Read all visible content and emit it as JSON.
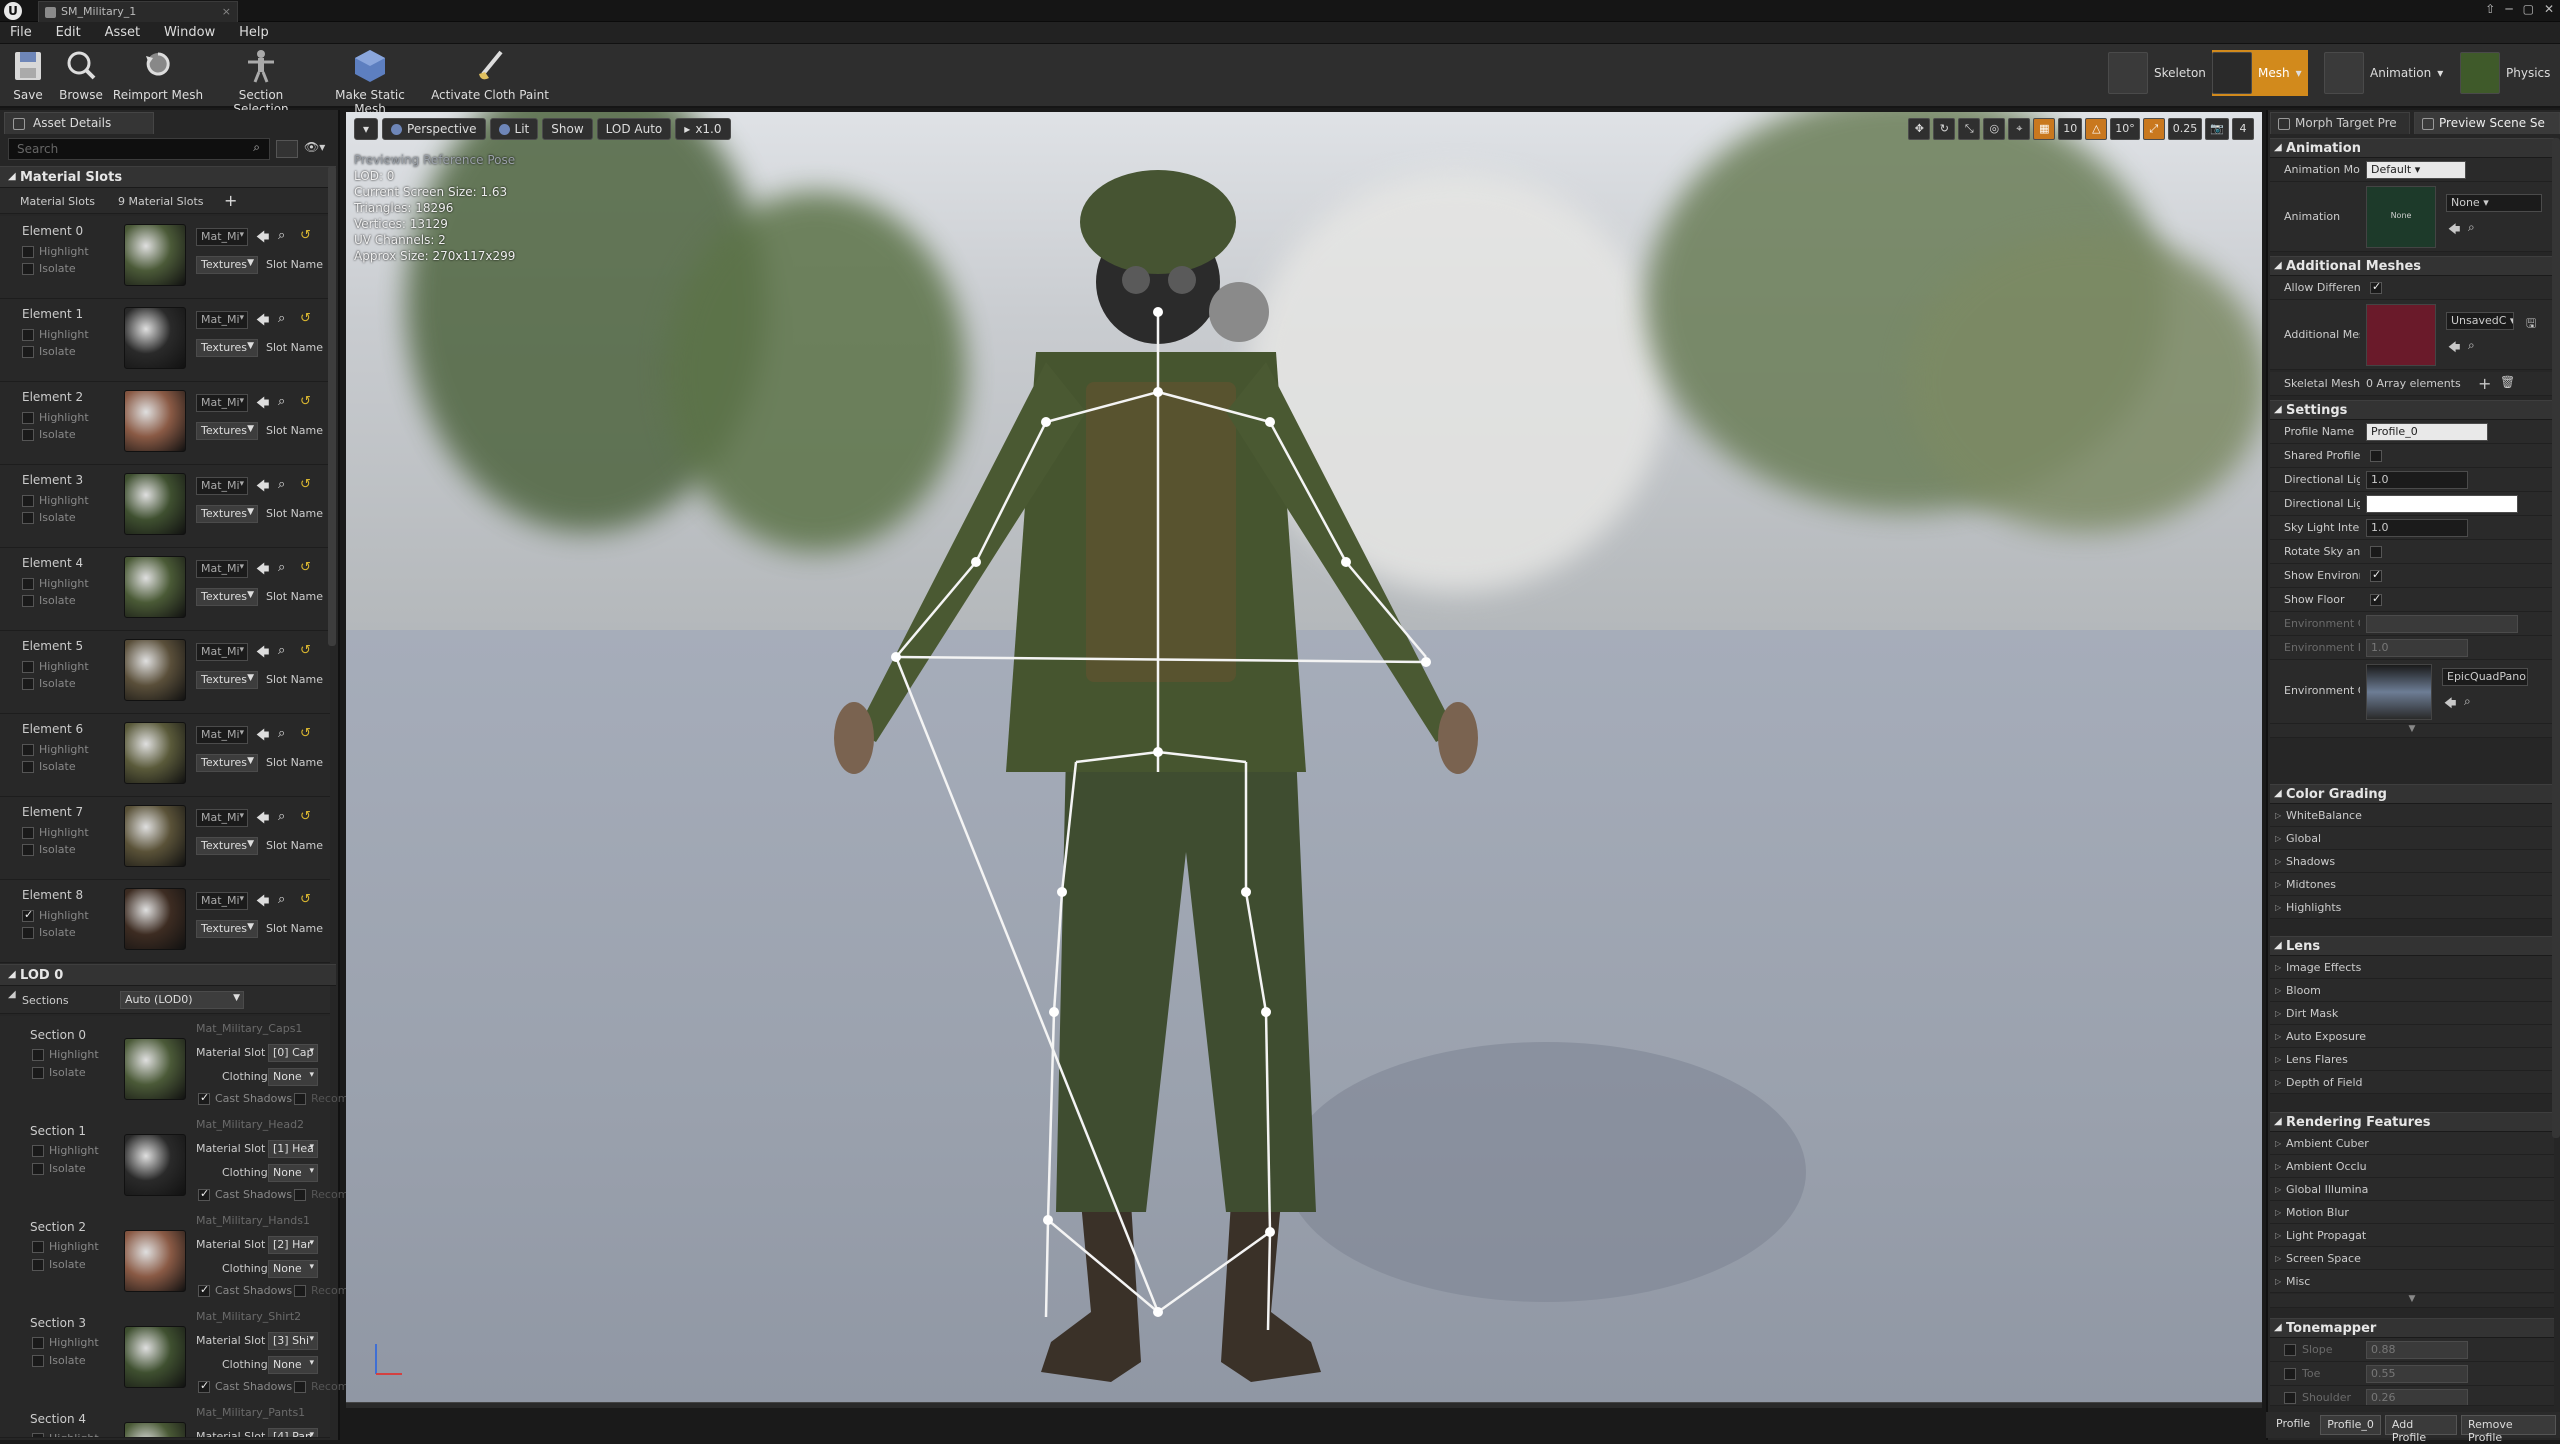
{
  "titlebar": {
    "tab_title": "SM_Military_1",
    "close": "×",
    "window_controls": [
      "⇧",
      "─",
      "▢",
      "✕"
    ]
  },
  "menu": {
    "items": [
      "File",
      "Edit",
      "Asset",
      "Window",
      "Help"
    ]
  },
  "toolbar": {
    "buttons": [
      "Save",
      "Browse",
      "Reimport Mesh",
      "Section Selection",
      "Make Static Mesh",
      "Activate Cloth Paint"
    ],
    "modes": [
      "Skeleton",
      "Mesh",
      "Animation",
      "Physics"
    ]
  },
  "asset_details": {
    "tab_label": "Asset Details",
    "search_placeholder": "Search",
    "material_slots_header": "Material Slots",
    "material_slots_label": "Material Slots",
    "material_slots_count": "9 Material Slots",
    "elements": [
      {
        "label": "Element 0",
        "material": "Mat_Mi",
        "highlight": false,
        "color": "#4b5a38"
      },
      {
        "label": "Element 1",
        "material": "Mat_Mi",
        "highlight": false,
        "color": "#2a2a2a"
      },
      {
        "label": "Element 2",
        "material": "Mat_Mi",
        "highlight": false,
        "color": "#8a5a45"
      },
      {
        "label": "Element 3",
        "material": "Mat_Mi",
        "highlight": false,
        "color": "#3f5030"
      },
      {
        "label": "Element 4",
        "material": "Mat_Mi",
        "highlight": false,
        "color": "#4a5a36"
      },
      {
        "label": "Element 5",
        "material": "Mat_Mi",
        "highlight": false,
        "color": "#5a4f3a"
      },
      {
        "label": "Element 6",
        "material": "Mat_Mi",
        "highlight": false,
        "color": "#5a5a3a"
      },
      {
        "label": "Element 7",
        "material": "Mat_Mi",
        "highlight": false,
        "color": "#5a5238"
      },
      {
        "label": "Element 8",
        "material": "Mat_Mi",
        "highlight": true,
        "color": "#3d2c22"
      }
    ],
    "element_labels": {
      "highlight": "Highlight",
      "isolate": "Isolate",
      "textures": "Textures",
      "slot_name": "Slot Name"
    },
    "lod_header": "LOD 0",
    "sections_label": "Sections",
    "sections_value": "Auto (LOD0)",
    "sections": [
      {
        "label": "Section 0",
        "material": "Mat_Military_Caps1",
        "slot": "[0] Cap",
        "color": "#4b5a38"
      },
      {
        "label": "Section 1",
        "material": "Mat_Military_Head2",
        "slot": "[1] Hea",
        "color": "#2a2a2a"
      },
      {
        "label": "Section 2",
        "material": "Mat_Military_Hands1",
        "slot": "[2] Har",
        "color": "#8a5a45"
      },
      {
        "label": "Section 3",
        "material": "Mat_Military_Shirt2",
        "slot": "[3] Shi",
        "color": "#3f5030"
      },
      {
        "label": "Section 4",
        "material": "Mat_Military_Pants1",
        "slot": "[4] Pan",
        "color": "#4a5a36"
      }
    ],
    "section_labels": {
      "material_slot": "Material Slot",
      "clothing": "Clothing",
      "clothing_value": "None",
      "cast_shadows": "Cast Shadows",
      "recompute": "Recom",
      "highlight": "Highlight",
      "isolate": "Isolate"
    }
  },
  "viewport": {
    "buttons": [
      "Perspective",
      "Lit",
      "Show",
      "LOD Auto",
      "x1.0"
    ],
    "stats": {
      "preview": "Previewing Reference Pose",
      "lod": "LOD: 0",
      "screen_size": "Current Screen Size: 1.63",
      "triangles": "Triangles: 18296",
      "vertices": "Vertices: 13129",
      "uv": "UV Channels: 2",
      "size": "Approx Size: 270x117x299"
    },
    "right_tools": [
      "10",
      "10°",
      "0.25",
      "4"
    ]
  },
  "preview_settings": {
    "tabs": [
      "Morph Target Pre",
      "Preview Scene Se"
    ],
    "animation_header": "Animation",
    "animation_mode_label": "Animation Mod",
    "animation_mode_value": "Default",
    "animation_label": "Animation",
    "animation_value": "None",
    "animation_thumb": "None",
    "additional_meshes_header": "Additional Meshes",
    "allow_different_label": "Allow Different",
    "additional_mesh_label": "Additional Mes",
    "additional_mesh_value": "UnsavedC",
    "skeletal_meshes_label": "Skeletal Meshe",
    "skeletal_meshes_value": "0 Array elements",
    "settings_header": "Settings",
    "profile_name_label": "Profile Name",
    "profile_name_value": "Profile_0",
    "shared_profile_label": "Shared Profile",
    "dir_light_label": "Directional Ligh",
    "dir_light_value": "1.0",
    "dir_light_color_label": "Directional Ligh",
    "sky_light_label": "Sky Light Inten",
    "sky_light_value": "1.0",
    "rotate_sky_label": "Rotate Sky and",
    "show_env_label": "Show Environm",
    "show_floor_label": "Show Floor",
    "env_color_label": "Environment C",
    "env_intensity_label": "Environment In",
    "env_intensity_value": "1.0",
    "env_cubemap_label": "Environment Cu",
    "env_cubemap_value": "EpicQuadPano",
    "color_grading_header": "Color Grading",
    "color_grading_items": [
      "WhiteBalance",
      "Global",
      "Shadows",
      "Midtones",
      "Highlights"
    ],
    "lens_header": "Lens",
    "lens_items": [
      "Image Effects",
      "Bloom",
      "Dirt Mask",
      "Auto Exposure",
      "Lens Flares",
      "Depth of Field"
    ],
    "rendering_header": "Rendering Features",
    "rendering_items": [
      "Ambient Cuber",
      "Ambient Occlu",
      "Global Illumina",
      "Motion Blur",
      "Light Propagat",
      "Screen Space",
      "Misc"
    ],
    "tonemapper_header": "Tonemapper",
    "tonemapper_slope_label": "Slope",
    "tonemapper_slope_value": "0.88",
    "tonemapper_toe_label": "Toe",
    "tonemapper_toe_value": "0.55",
    "tonemapper_shoulder_label": "Shoulder",
    "tonemapper_shoulder_value": "0.26",
    "bottom_profile_label": "Profile",
    "bottom_profile_value": "Profile_0",
    "add_profile": "Add Profile",
    "remove_profile": "Remove Profile"
  }
}
